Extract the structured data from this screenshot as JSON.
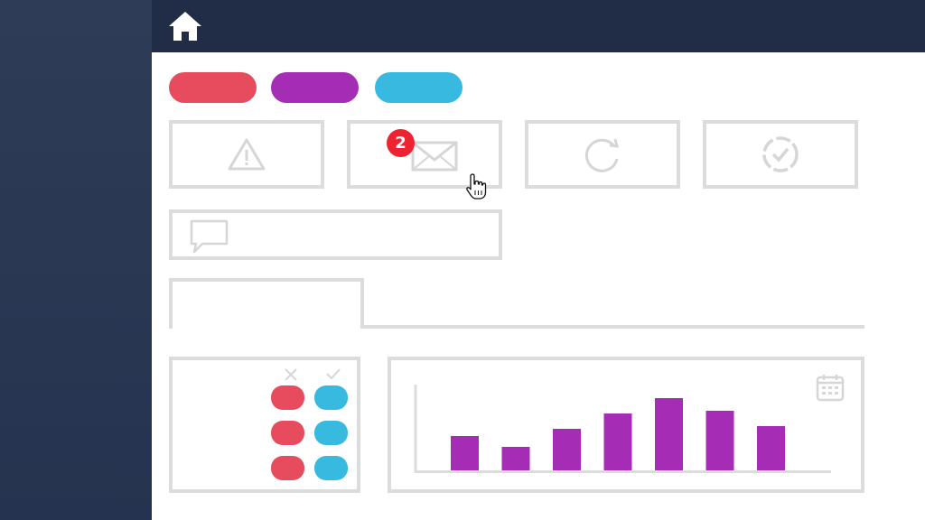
{
  "colors": {
    "sidebar": "#2e3c57",
    "topbar": "#212d47",
    "red": "#e74c5e",
    "purple": "#a52db5",
    "cyan": "#38b9df",
    "border": "#dcdcdc",
    "icon": "#d6d6d6",
    "badge": "#ee2331"
  },
  "topbar": {
    "home_icon": "home-icon"
  },
  "pills": [
    {
      "color": "red"
    },
    {
      "color": "purple"
    },
    {
      "color": "cyan"
    }
  ],
  "cards": [
    {
      "icon": "warning-icon"
    },
    {
      "icon": "mail-icon",
      "badge": "2"
    },
    {
      "icon": "refresh-icon"
    },
    {
      "icon": "check-circle-icon"
    }
  ],
  "comment_box": {
    "icon": "speech-bubble-icon"
  },
  "toggles_panel": {
    "reject_icon": "x-icon",
    "accept_icon": "check-icon",
    "rows": 3
  },
  "chart_panel": {
    "icon": "calendar-icon",
    "chart_data": {
      "type": "bar",
      "values": [
        38,
        26,
        46,
        63,
        80,
        66,
        49
      ],
      "ylim": [
        0,
        100
      ],
      "color": "purple"
    }
  }
}
